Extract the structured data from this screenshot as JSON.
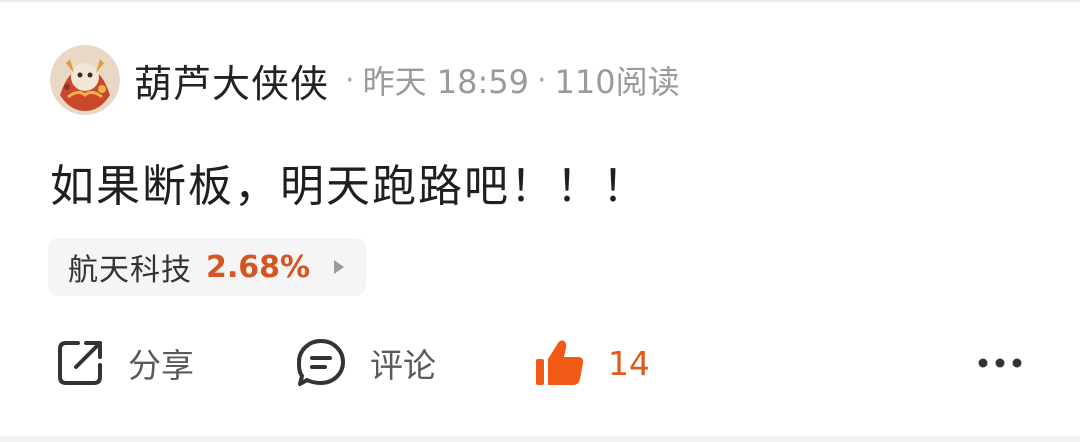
{
  "post": {
    "author": "葫芦大侠侠",
    "time": "昨天 18:59",
    "reads": "110阅读",
    "separator": "·",
    "content": "如果断板，明天跑路吧！！！"
  },
  "stock": {
    "name": "航天科技",
    "change": "2.68%",
    "change_color": "#d4551f"
  },
  "actions": {
    "share_label": "分享",
    "comment_label": "评论",
    "like_count": "14",
    "like_color": "#e05a1a",
    "more_icon": "more-dots-icon"
  }
}
